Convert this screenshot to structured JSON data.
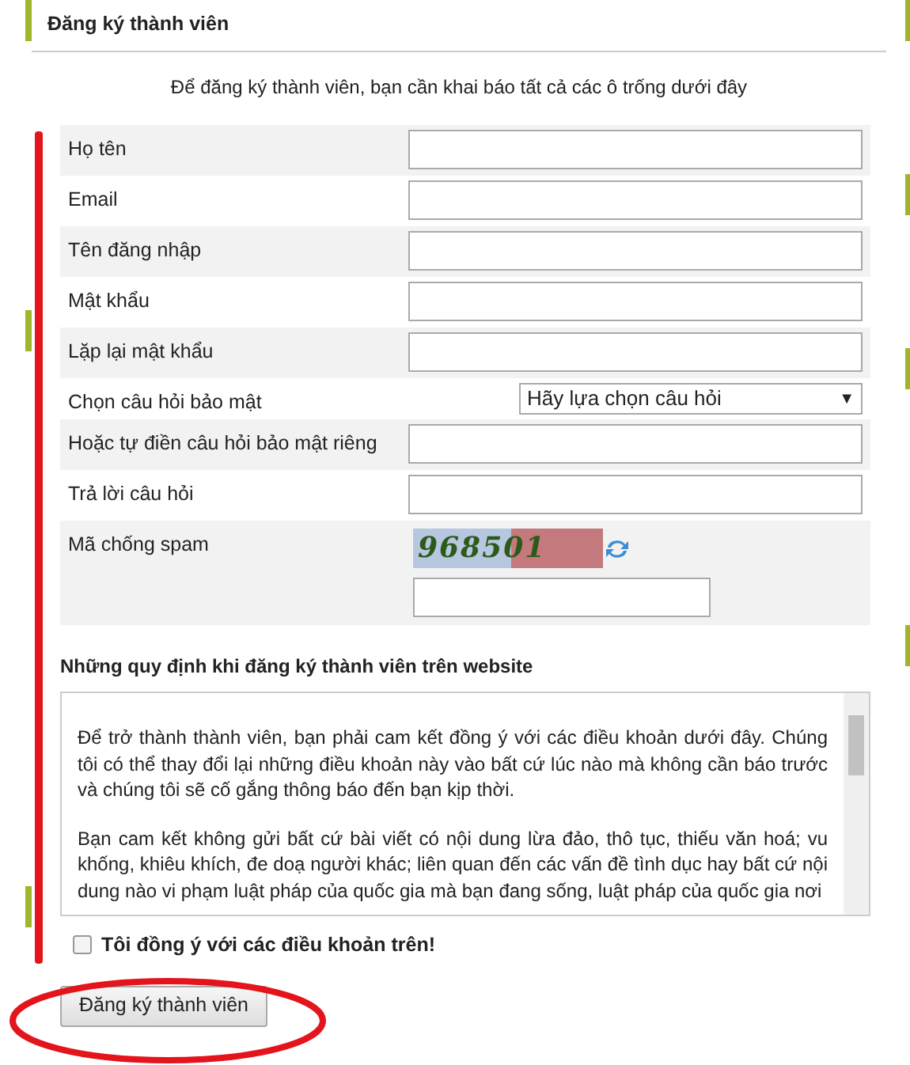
{
  "panel": {
    "title": "Đăng ký thành viên",
    "intro": "Để đăng ký thành viên, bạn cần khai báo tất cả các ô trống dưới đây"
  },
  "fields": [
    {
      "kind": "text",
      "label": "Họ tên"
    },
    {
      "kind": "text",
      "label": "Email"
    },
    {
      "kind": "text",
      "label": "Tên đăng nhập"
    },
    {
      "kind": "text",
      "label": "Mật khẩu"
    },
    {
      "kind": "text",
      "label": "Lặp lại mật khẩu"
    },
    {
      "kind": "select",
      "label": "Chọn câu hỏi bảo mật",
      "value": "Hãy lựa chọn câu hỏi",
      "caret": "▼"
    },
    {
      "kind": "text",
      "label": "Hoặc tự điền câu hỏi bảo mật riêng"
    },
    {
      "kind": "text",
      "label": "Trả lời câu hỏi"
    },
    {
      "kind": "captcha",
      "label": "Mã chống spam",
      "code": "968501"
    }
  ],
  "rules": {
    "title": "Những quy định khi đăng ký thành viên trên website",
    "paragraphs": [
      "Để trở thành thành viên, bạn phải cam kết đồng ý với các điều khoản dưới đây. Chúng tôi có thể thay đổi lại những điều khoản này vào bất cứ lúc nào mà không cần báo trước và chúng tôi sẽ cố gắng thông báo đến bạn kịp thời.",
      "Bạn cam kết không gửi bất cứ bài viết có nội dung lừa đảo, thô tục, thiếu văn hoá; vu khống, khiêu khích, đe doạ người khác; liên quan đến các vấn đề tình dục hay bất cứ nội dung nào vi phạm luật pháp của quốc gia mà bạn đang sống, luật pháp của quốc gia nơi"
    ]
  },
  "agree": {
    "label": "Tôi đồng ý với các điều khoản trên!",
    "checked": false
  },
  "submit": "Đăng ký thành viên"
}
